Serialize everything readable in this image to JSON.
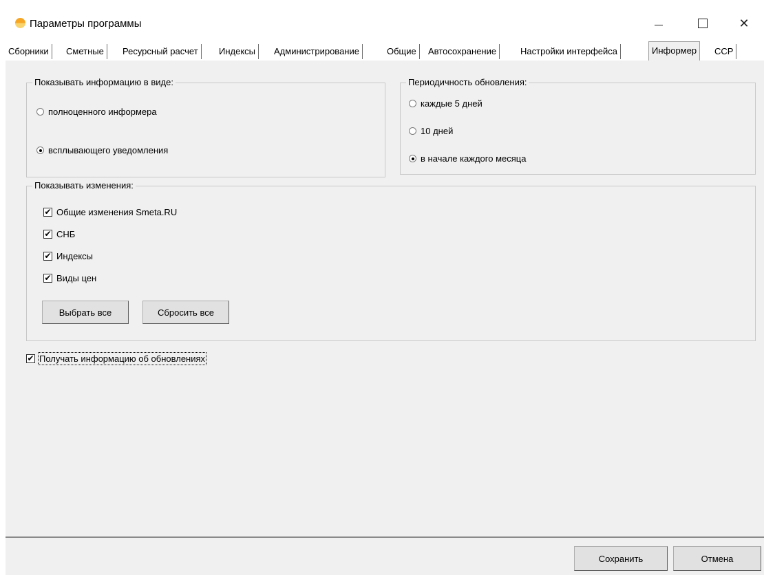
{
  "window": {
    "title": "Параметры программы"
  },
  "tabs": [
    {
      "label": "Сборники"
    },
    {
      "label": "Сметные"
    },
    {
      "label": "Ресурсный расчет"
    },
    {
      "label": "Индексы"
    },
    {
      "label": "Администрирование"
    },
    {
      "label": "Общие"
    },
    {
      "label": "Автосохранение"
    },
    {
      "label": "Настройки интерфейса"
    },
    {
      "label": "Информер",
      "active": true
    },
    {
      "label": "ССР"
    }
  ],
  "display_mode": {
    "legend": "Показывать информацию в виде:",
    "options": [
      {
        "label": "полноценного информера",
        "selected": false
      },
      {
        "label": "всплывающего уведомления",
        "selected": true
      }
    ]
  },
  "update_period": {
    "legend": "Периодичность обновления:",
    "options": [
      {
        "label": "каждые 5 дней",
        "selected": false
      },
      {
        "label": "10 дней",
        "selected": false
      },
      {
        "label": "в начале каждого месяца",
        "selected": true
      }
    ]
  },
  "changes": {
    "legend": "Показывать изменения:",
    "items": [
      {
        "label": "Общие изменения Smeta.RU",
        "checked": true
      },
      {
        "label": "СНБ",
        "checked": true
      },
      {
        "label": "Индексы",
        "checked": true
      },
      {
        "label": "Виды цен",
        "checked": true
      }
    ],
    "select_all_label": "Выбрать все",
    "reset_all_label": "Сбросить все"
  },
  "receive_updates": {
    "label": "Получать информацию об обновлениях",
    "checked": true
  },
  "footer": {
    "save_label": "Сохранить",
    "cancel_label": "Отмена"
  },
  "check_mark": "✔"
}
